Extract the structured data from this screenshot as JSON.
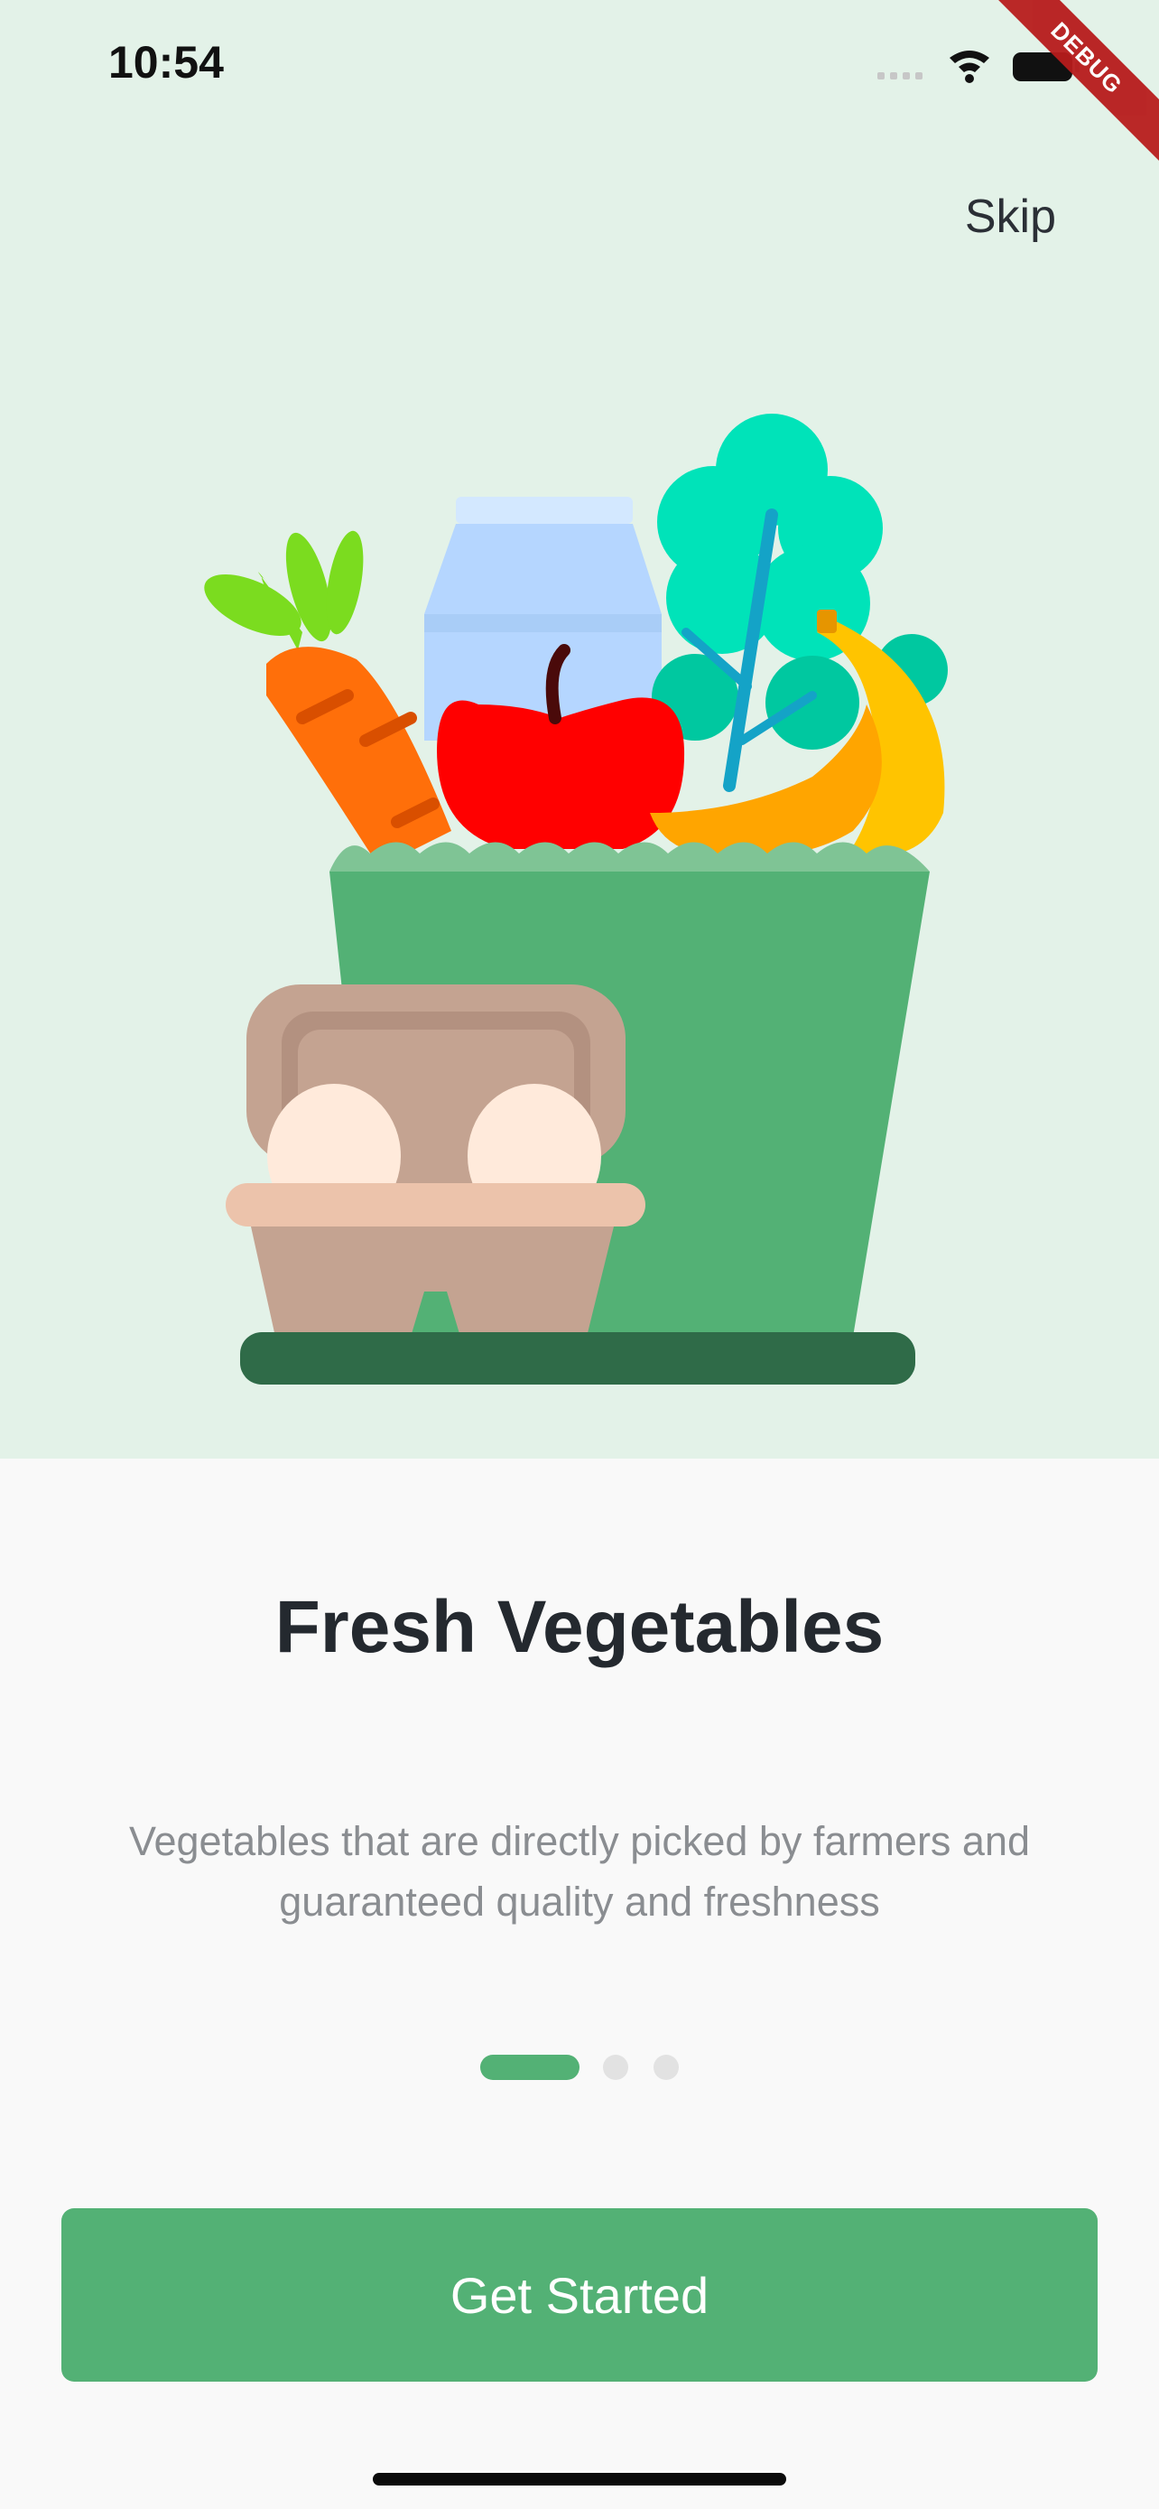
{
  "status_bar": {
    "time": "10:54",
    "icons": [
      "signal-icon",
      "wifi-icon",
      "battery-icon"
    ]
  },
  "debug_banner": "DEBUG",
  "skip_label": "Skip",
  "illustration": {
    "name": "grocery-bag-illustration",
    "items": [
      "carrot",
      "milk-carton",
      "apple",
      "lettuce",
      "banana",
      "grocery-bag",
      "egg-carton"
    ]
  },
  "onboarding": {
    "title": "Fresh Vegetables",
    "subtitle": "Vegetables that are directly picked by farmers and guaranteed quality and freshness",
    "page_count": 3,
    "active_page": 1
  },
  "cta_label": "Get Started",
  "colors": {
    "accent": "#53b175",
    "hero_background": "#e3f2e8",
    "page_background": "#f9f9f9",
    "title": "#24292f",
    "subtitle": "#8a8d91",
    "inactive_dot": "#e2e2e2",
    "debug_banner": "#b71c1c"
  }
}
